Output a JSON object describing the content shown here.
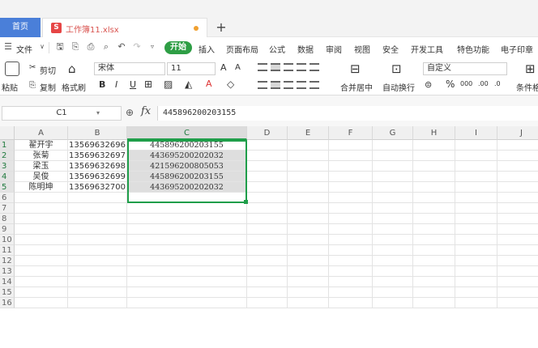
{
  "tabs": {
    "home": "首页",
    "file": "工作簿11.xlsx",
    "file_icon": "S",
    "add": "+"
  },
  "menu": {
    "file": "文件",
    "start": "开始",
    "items": [
      "插入",
      "页面布局",
      "公式",
      "数据",
      "审阅",
      "视图",
      "安全",
      "开发工具",
      "特色功能",
      "电子印章"
    ]
  },
  "ribbon": {
    "cut": "剪切",
    "paste": "粘贴",
    "copy": "复制",
    "format_painter": "格式刷",
    "font_name": "宋体",
    "font_size": "11",
    "merge_center": "合并居中",
    "wrap_text": "自动换行",
    "number_format": "自定义",
    "conditional_format": "条件格"
  },
  "formula_bar": {
    "name_box": "C1",
    "fx": "fx",
    "value": "445896200203155"
  },
  "columns": [
    "A",
    "B",
    "C",
    "D",
    "E",
    "F",
    "G",
    "H",
    "I",
    "J"
  ],
  "rows": [
    {
      "num": "1",
      "a": "翟开宇",
      "b": "13569632696",
      "c": "445896200203155"
    },
    {
      "num": "2",
      "a": "张菊",
      "b": "13569632697",
      "c": "443695200202032"
    },
    {
      "num": "3",
      "a": "梁玉",
      "b": "13569632698",
      "c": "421596200805053"
    },
    {
      "num": "4",
      "a": "吴俊",
      "b": "13569632699",
      "c": "445896200203155"
    },
    {
      "num": "5",
      "a": "陈明坤",
      "b": "13569632700",
      "c": "443695200202032"
    },
    {
      "num": "6"
    },
    {
      "num": "7"
    },
    {
      "num": "8"
    },
    {
      "num": "9"
    },
    {
      "num": "10"
    },
    {
      "num": "11"
    },
    {
      "num": "12"
    },
    {
      "num": "13"
    },
    {
      "num": "14"
    },
    {
      "num": "15"
    },
    {
      "num": "16"
    }
  ],
  "colors": {
    "accent": "#1f9e4a",
    "home_tab": "#4a7fd9",
    "start_button": "#2e9e45",
    "file_name": "#d9534f"
  }
}
